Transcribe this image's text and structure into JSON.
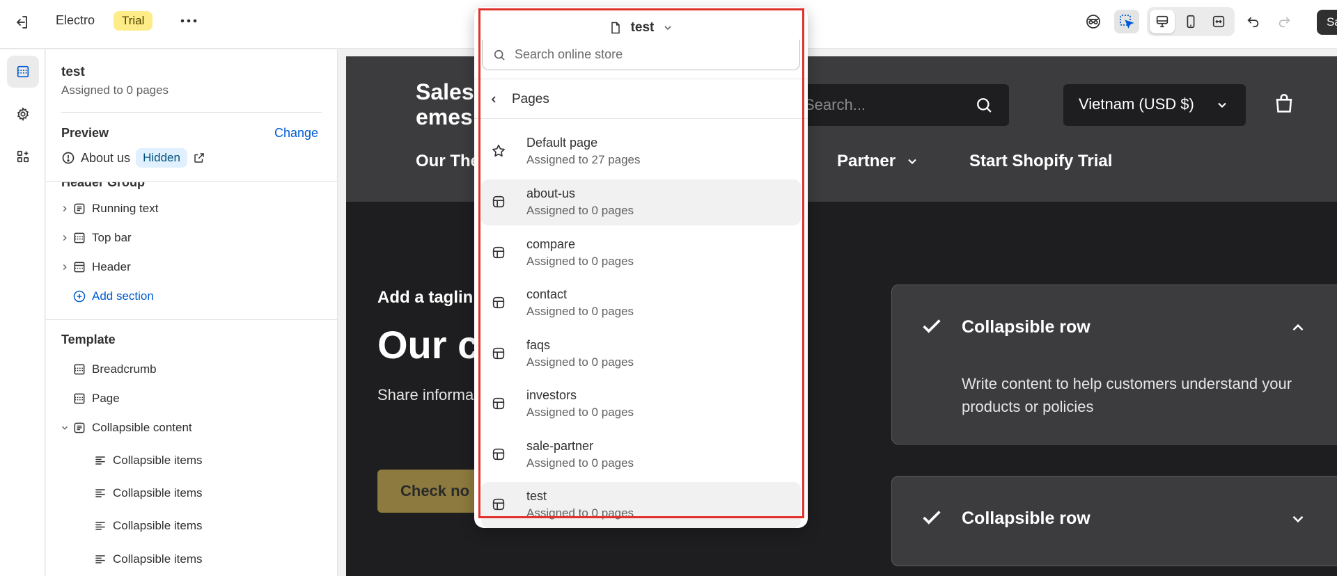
{
  "topbar": {
    "store_name": "Electro",
    "plan_badge": "Trial",
    "save_label": "Sa"
  },
  "sidebar": {
    "template_title": "test",
    "template_sub": "Assigned to 0 pages",
    "preview_label": "Preview",
    "change_label": "Change",
    "preview_page": "About us",
    "preview_status": "Hidden",
    "header_group_label": "Header Group",
    "header_items": [
      {
        "label": "Running text"
      },
      {
        "label": "Top bar"
      },
      {
        "label": "Header"
      }
    ],
    "add_section_label": "Add section",
    "template_label": "Template",
    "template_items": [
      {
        "label": "Breadcrumb"
      },
      {
        "label": "Page"
      },
      {
        "label": "Collapsible content"
      }
    ],
    "collapsible_children": [
      {
        "label": "Collapsible items"
      },
      {
        "label": "Collapsible items"
      },
      {
        "label": "Collapsible items"
      },
      {
        "label": "Collapsible items"
      }
    ]
  },
  "site": {
    "logo_line1": "Sales",
    "logo_line2": "emes",
    "search_placeholder": "Search...",
    "country_label": "Vietnam (USD $)",
    "nav": [
      "Our The",
      "Partner",
      "Start Shopify Trial"
    ],
    "tagline": "Add a taglin",
    "headline": "Our co",
    "share_text": "Share informa",
    "cta_label": "Check no",
    "collapsible_rows": [
      {
        "title": "Collapsible row",
        "body": "Write content to help customers understand your products or policies",
        "expanded": true
      },
      {
        "title": "Collapsible row",
        "body": "",
        "expanded": false
      }
    ]
  },
  "picker": {
    "current_template": "test",
    "search_placeholder": "Search online store",
    "section_label": "Pages",
    "pages": [
      {
        "name": "Default page",
        "sub": "Assigned to 27 pages",
        "icon": "star-icon"
      },
      {
        "name": "about-us",
        "sub": "Assigned to 0 pages",
        "icon": "template-icon"
      },
      {
        "name": "compare",
        "sub": "Assigned to 0 pages",
        "icon": "template-icon"
      },
      {
        "name": "contact",
        "sub": "Assigned to 0 pages",
        "icon": "template-icon"
      },
      {
        "name": "faqs",
        "sub": "Assigned to 0 pages",
        "icon": "template-icon"
      },
      {
        "name": "investors",
        "sub": "Assigned to 0 pages",
        "icon": "template-icon"
      },
      {
        "name": "sale-partner",
        "sub": "Assigned to 0 pages",
        "icon": "template-icon"
      },
      {
        "name": "test",
        "sub": "Assigned to 0 pages",
        "icon": "template-icon"
      }
    ]
  },
  "colors": {
    "accent_blue": "#005bd3",
    "trial_yellow": "#fdec88",
    "highlight_red": "#e0312b",
    "site_dark": "#1e1e20",
    "site_header": "#3c3c3e",
    "cta_gold": "#8c7a3e"
  }
}
